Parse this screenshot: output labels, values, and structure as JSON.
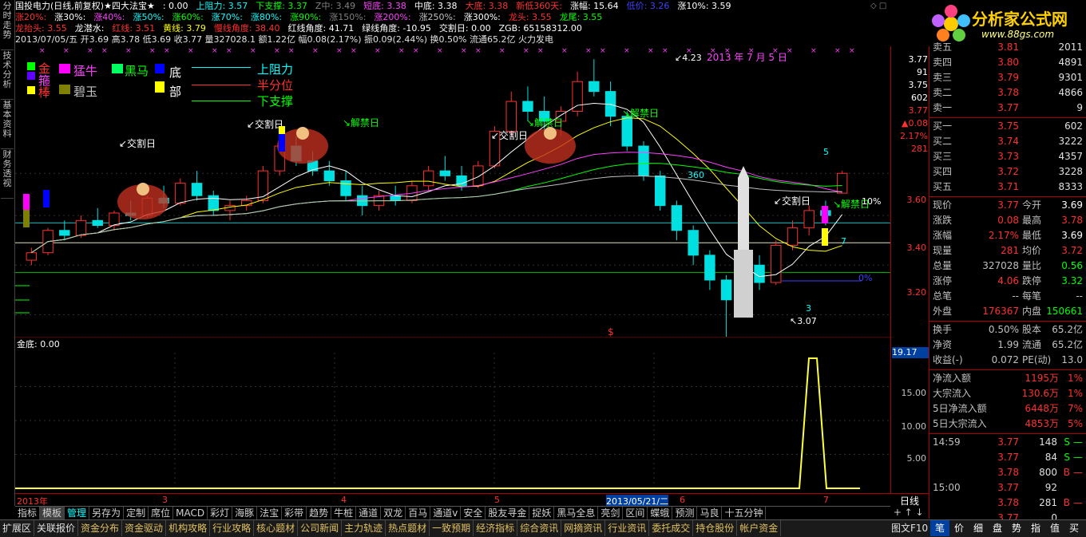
{
  "leftbar": {
    "tabs": [
      "分时走势",
      "技术分析",
      "基本资料",
      "财务透视"
    ]
  },
  "header": {
    "line1": [
      {
        "t": "国投电力(日线,前复权)★四大法宝★",
        "c": "#ffffff"
      },
      {
        "t": ": 0.00",
        "c": "#ffffff"
      },
      {
        "t": "上阻力: 3.57",
        "c": "#00ffff"
      },
      {
        "t": "下支撑: 3.37",
        "c": "#00ff00"
      },
      {
        "t": "Z中: 3.49",
        "c": "#808080"
      },
      {
        "t": "短底: 3.38",
        "c": "#ff40ff"
      },
      {
        "t": "中底: 3.38",
        "c": "#ffffff"
      },
      {
        "t": "大底: 3.38",
        "c": "#ff3030"
      },
      {
        "t": "新低360天:",
        "c": "#ff3030"
      },
      {
        "t": "涨幅: 15.64",
        "c": "#ffffff"
      },
      {
        "t": "低价: 3.26",
        "c": "#4040ff"
      },
      {
        "t": "涨10%: 3.59",
        "c": "#ffffff"
      }
    ],
    "line2": [
      {
        "t": "涨20%:",
        "c": "#ff3030"
      },
      {
        "t": "涨30%:",
        "c": "#ffffff"
      },
      {
        "t": "涨40%:",
        "c": "#ff40ff"
      },
      {
        "t": "涨50%:",
        "c": "#00ffff"
      },
      {
        "t": "涨60%:",
        "c": "#00ff00"
      },
      {
        "t": "涨70%:",
        "c": "#00ffff"
      },
      {
        "t": "涨80%:",
        "c": "#00ffff"
      },
      {
        "t": "涨90%:",
        "c": "#00ff00"
      },
      {
        "t": "涨150%:",
        "c": "#808080"
      },
      {
        "t": "涨200%:",
        "c": "#ff40ff"
      },
      {
        "t": "涨250%:",
        "c": "#c0c0c0"
      },
      {
        "t": "涨300%:",
        "c": "#ffffff"
      },
      {
        "t": "龙头: 3.55",
        "c": "#ff3030"
      },
      {
        "t": "龙尾: 3.55",
        "c": "#00ff00"
      }
    ],
    "line3": [
      {
        "t": "龙抬头: 3.55",
        "c": "#ff3030"
      },
      {
        "t": "龙潜水:",
        "c": "#ffffff"
      },
      {
        "t": "红线: 3.51",
        "c": "#ff3030"
      },
      {
        "t": "黄线: 3.79",
        "c": "#ffff00"
      },
      {
        "t": "慢线角度: 38.40",
        "c": "#ff3030"
      },
      {
        "t": "红线角度: 41.71",
        "c": "#ffffff"
      },
      {
        "t": "绿线角度: -10.95",
        "c": "#ffffff"
      },
      {
        "t": "交割日: 0.00",
        "c": "#ffffff"
      },
      {
        "t": "ZGB: 65158312.00",
        "c": "#ffffff"
      }
    ],
    "line4": "2013/07/05/五 开3.69 高3.78 低3.69 收3.77 量327028.1 额1.22亿 幅0.08(2.17%) 振0.09(2.44%) 换0.50% 流通65.2亿 火力发电"
  },
  "legend": {
    "items": [
      {
        "t": "金",
        "c": "#ff3030"
      },
      {
        "t": "猛牛",
        "c": "#ff40ff"
      },
      {
        "t": "黑马",
        "c": "#00ff00"
      },
      {
        "t": "底",
        "c": "#ffffff"
      },
      {
        "t": "箍",
        "c": "#ff40ff"
      },
      {
        "t": "棒",
        "c": "#ff3030"
      },
      {
        "t": "碧玉",
        "c": "#c0c0c0"
      },
      {
        "t": "部",
        "c": "#ffffff"
      }
    ],
    "lines": [
      {
        "t": "上阻力",
        "c": "#00ffff"
      },
      {
        "t": "半分位",
        "c": "#ff3030"
      },
      {
        "t": "下支撑",
        "c": "#00ff00"
      }
    ]
  },
  "annotations": {
    "high": "4.23",
    "date": "2013 年 7 月 5 日",
    "low": "3.07",
    "jiaoge": "交割日",
    "jiejin": "解禁日",
    "pct10": "10%",
    "pct0": "0%",
    "n360": "360",
    "n5": "5",
    "n7": "7",
    "n3": "3",
    "sym": "$"
  },
  "chart_data": {
    "type": "candlestick",
    "title": "国投电力(日线,前复权)",
    "ylim": [
      3.15,
      4.25
    ],
    "yticks": [
      "3.77",
      "3.60",
      "3.40",
      "3.20"
    ],
    "dates": [
      "2013年",
      "3",
      "4",
      "5",
      "2013/05/21/二",
      "6",
      "7"
    ],
    "candles": [
      [
        3.42,
        3.47,
        3.4,
        3.45
      ],
      [
        3.45,
        3.55,
        3.44,
        3.54
      ],
      [
        3.54,
        3.58,
        3.5,
        3.52
      ],
      [
        3.52,
        3.6,
        3.51,
        3.58
      ],
      [
        3.58,
        3.63,
        3.55,
        3.56
      ],
      [
        3.56,
        3.62,
        3.54,
        3.61
      ],
      [
        3.61,
        3.66,
        3.58,
        3.6
      ],
      [
        3.6,
        3.68,
        3.59,
        3.67
      ],
      [
        3.67,
        3.72,
        3.63,
        3.65
      ],
      [
        3.65,
        3.75,
        3.64,
        3.73
      ],
      [
        3.73,
        3.78,
        3.66,
        3.68
      ],
      [
        3.68,
        3.7,
        3.6,
        3.62
      ],
      [
        3.62,
        3.66,
        3.58,
        3.64
      ],
      [
        3.64,
        3.68,
        3.62,
        3.66
      ],
      [
        3.66,
        3.8,
        3.65,
        3.78
      ],
      [
        3.78,
        3.9,
        3.76,
        3.88
      ],
      [
        3.88,
        3.92,
        3.8,
        3.82
      ],
      [
        3.82,
        3.86,
        3.76,
        3.78
      ],
      [
        3.78,
        3.82,
        3.72,
        3.74
      ],
      [
        3.74,
        3.78,
        3.66,
        3.68
      ],
      [
        3.68,
        3.72,
        3.6,
        3.64
      ],
      [
        3.64,
        3.7,
        3.62,
        3.68
      ],
      [
        3.68,
        3.72,
        3.64,
        3.66
      ],
      [
        3.66,
        3.74,
        3.65,
        3.72
      ],
      [
        3.72,
        3.8,
        3.7,
        3.78
      ],
      [
        3.78,
        3.84,
        3.74,
        3.76
      ],
      [
        3.76,
        3.8,
        3.7,
        3.72
      ],
      [
        3.72,
        3.82,
        3.71,
        3.8
      ],
      [
        3.8,
        3.96,
        3.79,
        3.94
      ],
      [
        3.94,
        4.1,
        3.92,
        4.06
      ],
      [
        4.06,
        4.12,
        3.98,
        4.02
      ],
      [
        4.02,
        4.08,
        3.94,
        3.98
      ],
      [
        3.98,
        4.04,
        3.92,
        4.02
      ],
      [
        4.02,
        4.18,
        4.0,
        4.14
      ],
      [
        4.14,
        4.23,
        4.08,
        4.1
      ],
      [
        4.1,
        4.14,
        3.96,
        4.0
      ],
      [
        4.0,
        4.02,
        3.86,
        3.88
      ],
      [
        3.88,
        3.9,
        3.74,
        3.76
      ],
      [
        3.76,
        3.78,
        3.62,
        3.64
      ],
      [
        3.64,
        3.66,
        3.5,
        3.54
      ],
      [
        3.54,
        3.56,
        3.4,
        3.44
      ],
      [
        3.44,
        3.46,
        3.3,
        3.34
      ],
      [
        3.34,
        3.36,
        3.07,
        3.26
      ],
      [
        3.26,
        3.42,
        3.24,
        3.4
      ],
      [
        3.4,
        3.44,
        3.3,
        3.33
      ],
      [
        3.33,
        3.5,
        3.32,
        3.48
      ],
      [
        3.48,
        3.58,
        3.46,
        3.55
      ],
      [
        3.55,
        3.64,
        3.52,
        3.62
      ],
      [
        3.62,
        3.66,
        3.56,
        3.6
      ],
      [
        3.69,
        3.78,
        3.69,
        3.77
      ]
    ],
    "sub_indicator": {
      "name": "金底",
      "value": "金底: 0.00",
      "yticks": [
        "19.17",
        "15.00",
        "10.00",
        "5.00"
      ],
      "spike_value": 19.17
    }
  },
  "quote": {
    "asks": [
      {
        "l": "卖五",
        "p": "3.81",
        "v": "2011"
      },
      {
        "l": "卖四",
        "p": "3.80",
        "v": "4891"
      },
      {
        "l": "卖三",
        "p": "3.79",
        "v": "9301"
      },
      {
        "l": "卖二",
        "p": "3.78",
        "v": "4866"
      },
      {
        "l": "卖一",
        "p": "3.77",
        "v": "9"
      }
    ],
    "bids": [
      {
        "l": "买一",
        "p": "3.75",
        "v": "602"
      },
      {
        "l": "买二",
        "p": "3.74",
        "v": "3222"
      },
      {
        "l": "买三",
        "p": "3.73",
        "v": "4357"
      },
      {
        "l": "买四",
        "p": "3.72",
        "v": "3228"
      },
      {
        "l": "买五",
        "p": "3.71",
        "v": "8333"
      }
    ],
    "stats": [
      {
        "l": "现价",
        "v": "3.77",
        "c": "#ff3030",
        "l2": "今开",
        "v2": "3.69",
        "c2": "#ffffff"
      },
      {
        "l": "涨跌",
        "v": "0.08",
        "c": "#ff3030",
        "l2": "最高",
        "v2": "3.78",
        "c2": "#ff3030"
      },
      {
        "l": "涨幅",
        "v": "2.17%",
        "c": "#ff3030",
        "l2": "最低",
        "v2": "3.69",
        "c2": "#ffffff"
      },
      {
        "l": "现量",
        "v": "281",
        "c": "#ff3030",
        "l2": "均价",
        "v2": "3.72",
        "c2": "#ff3030"
      },
      {
        "l": "总量",
        "v": "327028",
        "c": "#c0c0c0",
        "l2": "量比",
        "v2": "0.56",
        "c2": "#00ff00"
      },
      {
        "l": "涨停",
        "v": "4.06",
        "c": "#ff3030",
        "l2": "跌停",
        "v2": "3.32",
        "c2": "#00ff00"
      },
      {
        "l": "总笔",
        "v": "--",
        "c": "#c0c0c0",
        "l2": "每笔",
        "v2": "--",
        "c2": "#c0c0c0"
      },
      {
        "l": "外盘",
        "v": "176367",
        "c": "#ff3030",
        "l2": "内盘",
        "v2": "150661",
        "c2": "#00ff00"
      }
    ],
    "stats2": [
      {
        "l": "换手",
        "v": "0.50%",
        "l2": "股本",
        "v2": "65.2亿"
      },
      {
        "l": "净资",
        "v": "1.99",
        "l2": "流通",
        "v2": "65.2亿"
      },
      {
        "l": "收益(-)",
        "v": "0.072",
        "l2": "PE(动)",
        "v2": "13.0"
      }
    ],
    "flows": [
      {
        "l": "净流入额",
        "v": "1195万",
        "p": "1%"
      },
      {
        "l": "大宗流入",
        "v": "130.6万",
        "p": "1%"
      },
      {
        "l": "5日净流入额",
        "v": "6448万",
        "p": "7%"
      },
      {
        "l": "5日大宗流入",
        "v": "4853万",
        "p": "5%"
      }
    ],
    "ticks": [
      {
        "t": "14:59",
        "p": "3.77",
        "v": "148",
        "d": "S"
      },
      {
        "t": "",
        "p": "3.77",
        "v": "84",
        "d": "S"
      },
      {
        "t": "",
        "p": "3.78",
        "v": "800",
        "d": "B"
      },
      {
        "t": "15:00",
        "p": "3.77",
        "v": "92",
        "d": ""
      },
      {
        "t": "",
        "p": "3.78",
        "v": "281",
        "d": "B"
      },
      {
        "t": "",
        "p": "3.77",
        "v": "0",
        "d": ""
      }
    ],
    "scale": [
      "3.77",
      "91",
      "3.75",
      "602",
      "3.77",
      "0.08",
      "2.17%",
      "281"
    ],
    "period": "日线"
  },
  "tabs1": [
    "指标",
    "模板",
    "管理",
    "另存为",
    "定制",
    "席位",
    "MACD",
    "彩灯",
    "海豚",
    "法宝",
    "彩带",
    "趋势",
    "牛桩",
    "通道",
    "双龙",
    "百马",
    "通道v",
    "安全",
    "股友寻金",
    "捉妖",
    "黑马全息",
    "亮剑",
    "区间",
    "蝶蛾",
    "预测",
    "马良",
    "十五分钟"
  ],
  "tabs2": [
    "扩展区",
    "关联报价",
    "资金分布",
    "资金驱动",
    "机构攻略",
    "行业攻略",
    "核心题材",
    "公司新闻",
    "主力轨迹",
    "热点题材",
    "一致预期",
    "经济指标",
    "综合资讯",
    "网摘资讯",
    "行业资讯",
    "委托成交",
    "持仓股份",
    "帐户资金"
  ],
  "tabs2right": "图文F10",
  "bottomright": [
    "笔",
    "价",
    "细",
    "盘",
    "势",
    "指",
    "值",
    "买"
  ],
  "logo": {
    "text": "分析家公式网",
    "url": "www.88gs.com"
  }
}
